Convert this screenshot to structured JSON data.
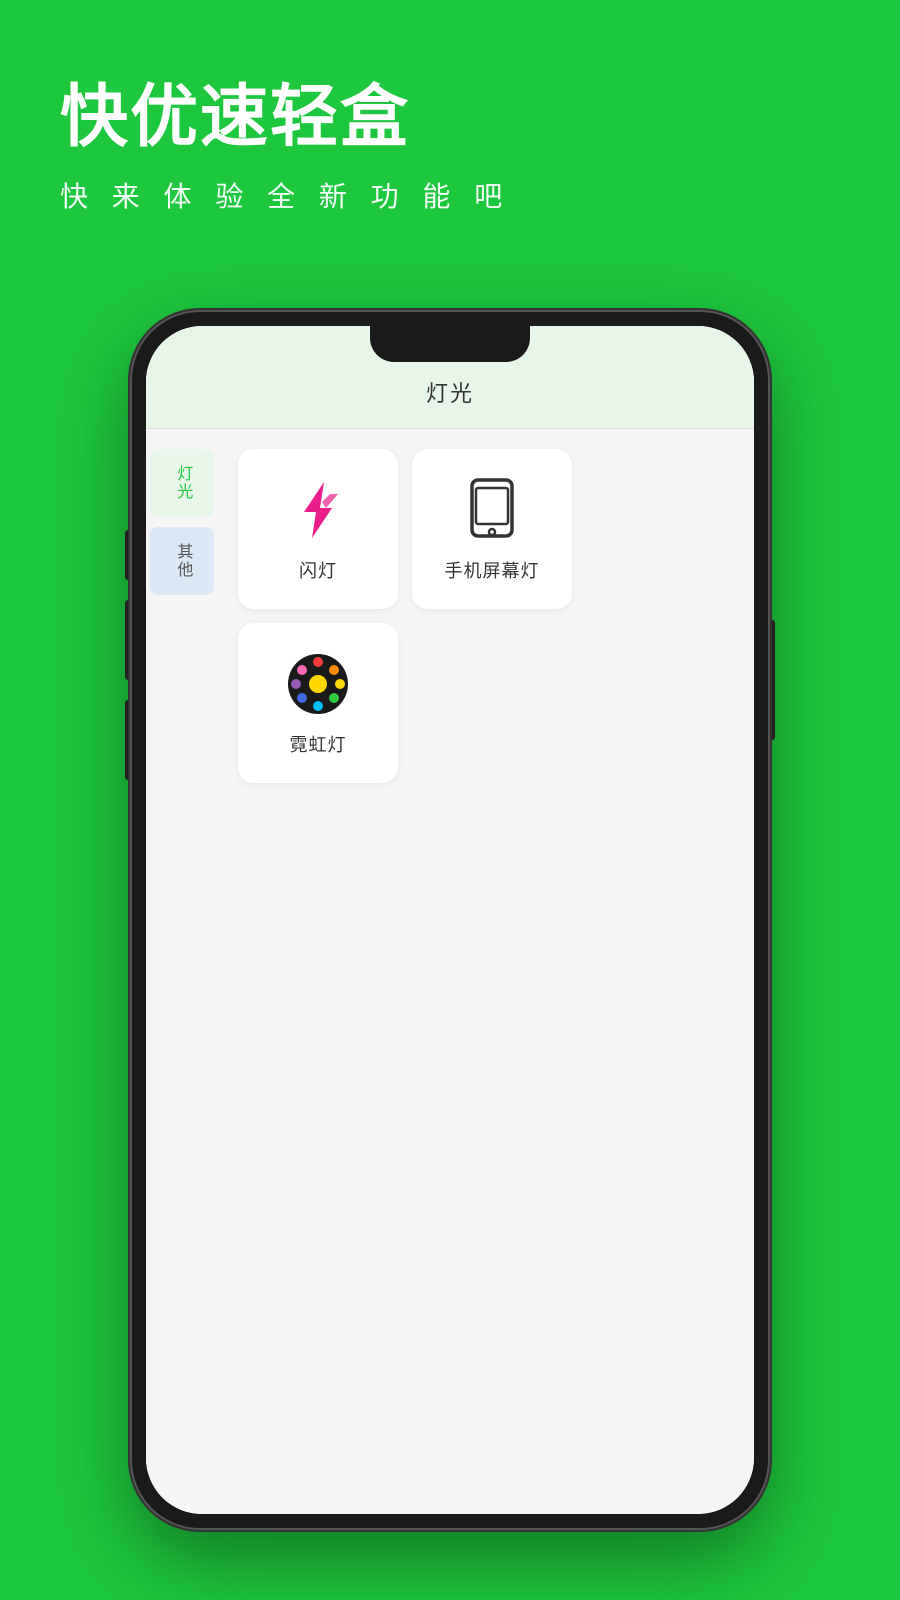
{
  "app": {
    "title": "快优速轻盒",
    "subtitle": "快 来 体 验 全 新 功 能 吧"
  },
  "screen": {
    "header_title": "灯光",
    "sidebar": [
      {
        "label": "灯光",
        "active": true
      },
      {
        "label": "其他",
        "active": false
      }
    ],
    "grid_items": [
      {
        "id": "flash",
        "label": "闪灯"
      },
      {
        "id": "phone-screen",
        "label": "手机屏幕灯"
      },
      {
        "id": "neon",
        "label": "霓虹灯"
      }
    ]
  },
  "colors": {
    "brand_green": "#1DC83E",
    "white": "#ffffff",
    "card_bg": "#ffffff",
    "sidebar_active_bg": "#e8f5e9",
    "sidebar_other_bg": "#dce8f5"
  }
}
